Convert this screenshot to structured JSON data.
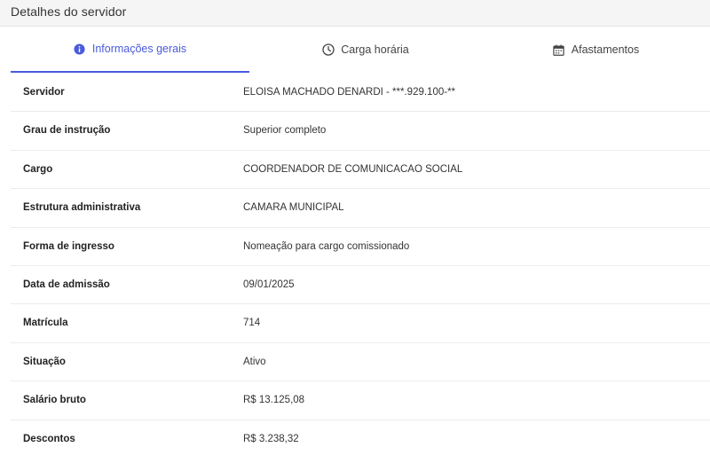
{
  "page": {
    "title": "Detalhes do servidor"
  },
  "tabs": [
    {
      "label": "Informações gerais",
      "icon": "info-icon",
      "active": true
    },
    {
      "label": "Carga horária",
      "icon": "clock-icon",
      "active": false
    },
    {
      "label": "Afastamentos",
      "icon": "calendar-icon",
      "active": false
    }
  ],
  "colors": {
    "accent": "#4a5bdc"
  },
  "details": [
    {
      "label": "Servidor",
      "value": "ELOISA MACHADO DENARDI - ***.929.100-**"
    },
    {
      "label": "Grau de instrução",
      "value": "Superior completo"
    },
    {
      "label": "Cargo",
      "value": "COORDENADOR DE COMUNICACAO SOCIAL"
    },
    {
      "label": "Estrutura administrativa",
      "value": "CAMARA MUNICIPAL"
    },
    {
      "label": "Forma de ingresso",
      "value": "Nomeação para cargo comissionado"
    },
    {
      "label": "Data de admissão",
      "value": "09/01/2025"
    },
    {
      "label": "Matrícula",
      "value": "714"
    },
    {
      "label": "Situação",
      "value": "Ativo"
    },
    {
      "label": "Salário bruto",
      "value": "R$ 13.125,08"
    },
    {
      "label": "Descontos",
      "value": "R$ 3.238,32"
    }
  ]
}
